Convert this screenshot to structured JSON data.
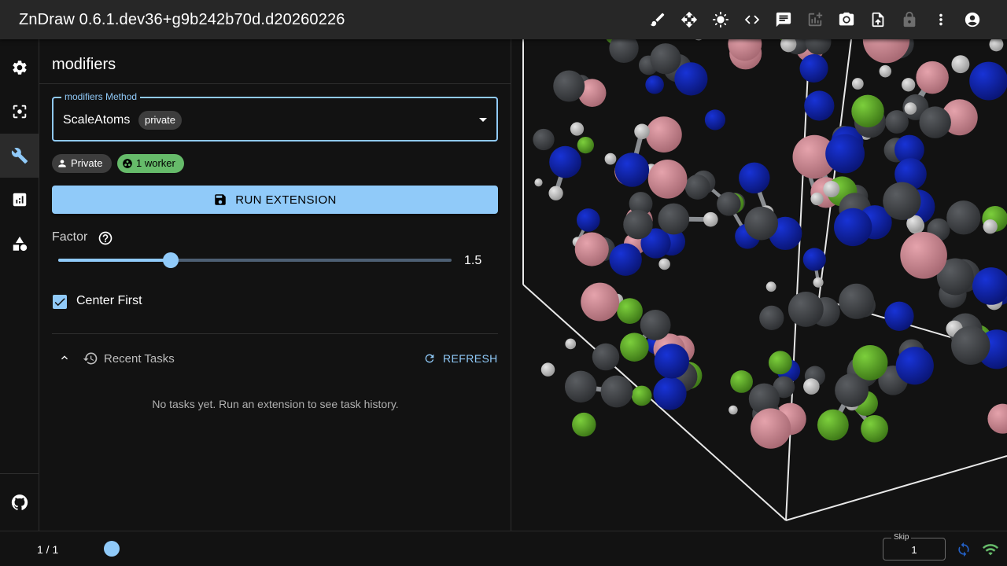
{
  "app": {
    "title": "ZnDraw 0.6.1.dev36+g9b242b70d.d20260226"
  },
  "toolbar": {
    "icons": [
      "brush-icon",
      "move-icon",
      "brightness-icon",
      "code-icon",
      "chat-icon",
      "add-chart-icon",
      "camera-icon",
      "upload-file-icon",
      "lock-icon",
      "more-vert-icon",
      "account-icon"
    ]
  },
  "rail": {
    "items": [
      "settings-icon",
      "selection-icon",
      "wrench-icon",
      "analysis-icon",
      "geometry-icon"
    ],
    "active": "wrench-icon",
    "footer": "github-icon"
  },
  "panel": {
    "title": "modifiers",
    "method": {
      "legend": "modifiers Method",
      "value": "ScaleAtoms",
      "chip": "private"
    },
    "visibility_chip": "Private",
    "worker_chip": "1 worker",
    "run_label": "RUN EXTENSION",
    "factor": {
      "label": "Factor",
      "value": "1.5",
      "fraction": 0.286
    },
    "center_first": {
      "label": "Center First",
      "checked": true
    },
    "recent": {
      "label": "Recent Tasks",
      "refresh_label": "REFRESH",
      "empty_message": "No tasks yet. Run an extension to see task history."
    }
  },
  "bottom": {
    "frame_counter": "1 / 1",
    "skip_legend": "Skip",
    "skip_value": "1"
  },
  "colors": {
    "accent": "#90caf9",
    "worker_chip": "#66bb6a",
    "carbon": "#5a5d61",
    "hydrogen": "#e6e6e6",
    "nitrogen": "#1833d6",
    "fluorine": "#7ccf3c",
    "boron": "#e5a3ac"
  }
}
